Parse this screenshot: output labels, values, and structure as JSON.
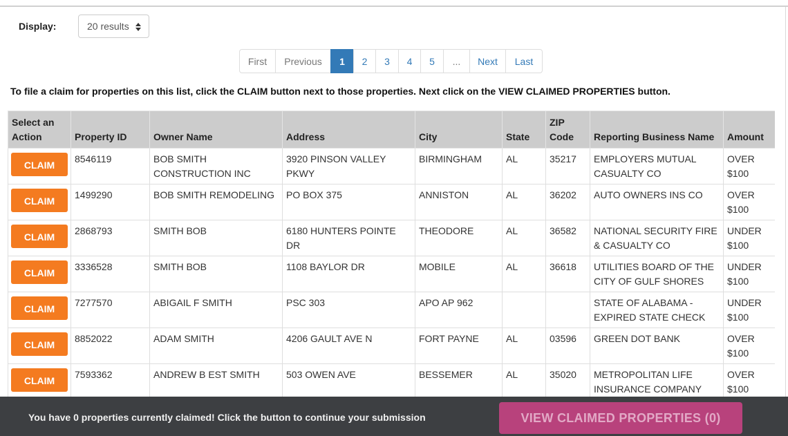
{
  "display": {
    "label": "Display:",
    "selected": "20 results"
  },
  "pagination": [
    "First",
    "Previous",
    "1",
    "2",
    "3",
    "4",
    "5",
    "...",
    "Next",
    "Last"
  ],
  "instructions": "To file a claim for properties on this list, click the CLAIM button next to those properties. Next click on the VIEW CLAIMED PROPERTIES button.",
  "table": {
    "headers": [
      "Select an Action",
      "Property ID",
      "Owner Name",
      "Address",
      "City",
      "State",
      "ZIP Code",
      "Reporting Business Name",
      "Amount"
    ],
    "claim_label": "CLAIM",
    "rows": [
      {
        "property_id": "8546119",
        "owner": "BOB SMITH CONSTRUCTION INC",
        "address": "3920 PINSON VALLEY PKWY",
        "city": "BIRMINGHAM",
        "state": "AL",
        "zip": "35217",
        "business": "EMPLOYERS MUTUAL CASUALTY CO",
        "amount": "OVER $100"
      },
      {
        "property_id": "1499290",
        "owner": "BOB SMITH REMODELING",
        "address": "PO BOX 375",
        "city": "ANNISTON",
        "state": "AL",
        "zip": "36202",
        "business": "AUTO OWNERS INS CO",
        "amount": "OVER $100"
      },
      {
        "property_id": "2868793",
        "owner": "SMITH BOB",
        "address": "6180 HUNTERS POINTE DR",
        "city": "THEODORE",
        "state": "AL",
        "zip": "36582",
        "business": "NATIONAL SECURITY FIRE & CASUALTY CO",
        "amount": "UNDER $100"
      },
      {
        "property_id": "3336528",
        "owner": "SMITH BOB",
        "address": "1108 BAYLOR DR",
        "city": "MOBILE",
        "state": "AL",
        "zip": "36618",
        "business": "UTILITIES BOARD OF THE CITY OF GULF SHORES",
        "amount": "UNDER $100"
      },
      {
        "property_id": "7277570",
        "owner": "ABIGAIL F SMITH",
        "address": "PSC 303",
        "city": "APO AP 962",
        "state": "",
        "zip": "",
        "business": "STATE OF ALABAMA - EXPIRED STATE CHECK",
        "amount": "UNDER $100"
      },
      {
        "property_id": "8852022",
        "owner": "ADAM SMITH",
        "address": "4206 GAULT AVE N",
        "city": "FORT PAYNE",
        "state": "AL",
        "zip": "03596",
        "business": "GREEN DOT BANK",
        "amount": "OVER $100"
      },
      {
        "property_id": "7593362",
        "owner": "ANDREW B EST SMITH",
        "address": "503 OWEN AVE",
        "city": "BESSEMER",
        "state": "AL",
        "zip": "35020",
        "business": "METROPOLITAN LIFE INSURANCE COMPANY",
        "amount": "OVER $100"
      }
    ]
  },
  "footer": {
    "message": "You have 0 properties currently claimed! Click the button to continue your submission",
    "button_label": "VIEW CLAIMED PROPERTIES (0)"
  },
  "colors": {
    "claim": "#f47b20",
    "active_page": "#337ab7",
    "footer_bg": "#3d3f42",
    "view_button": "#b8427c"
  }
}
